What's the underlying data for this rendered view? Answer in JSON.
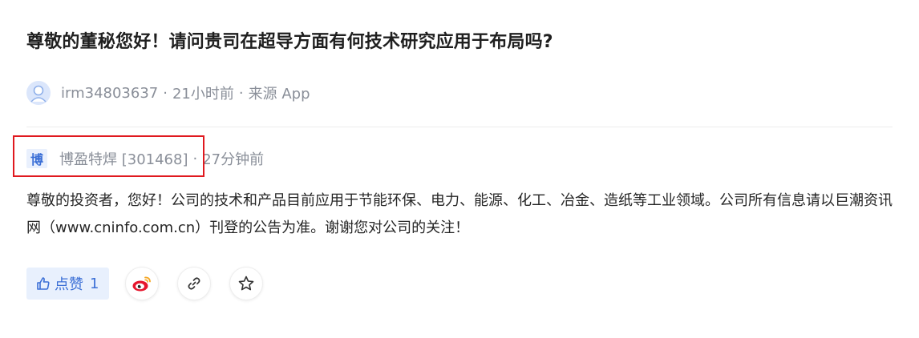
{
  "question": {
    "title": "尊敬的董秘您好！请问贵司在超导方面有何技术研究应用于布局吗?"
  },
  "asker": {
    "username": "irm34803637",
    "separator": "·",
    "time": "21小时前",
    "source": "来源 App"
  },
  "answer": {
    "badge": "博",
    "company": "博盈特焊 [301468]",
    "separator": "·",
    "time": "27分钟前",
    "text": "尊敬的投资者，您好！公司的技术和产品目前应用于节能环保、电力、能源、化工、冶金、造纸等工业领域。公司所有信息请以巨潮资讯网（www.cninfo.com.cn）刊登的公告为准。谢谢您对公司的关注！"
  },
  "actions": {
    "like_label": "点赞",
    "like_count": "1",
    "icons": [
      "thumbs-up-icon",
      "weibo-icon",
      "link-icon",
      "star-icon"
    ]
  },
  "colors": {
    "accent": "#3b6fd6",
    "highlight_border": "#e0191f",
    "muted_text": "#8a8f99"
  }
}
